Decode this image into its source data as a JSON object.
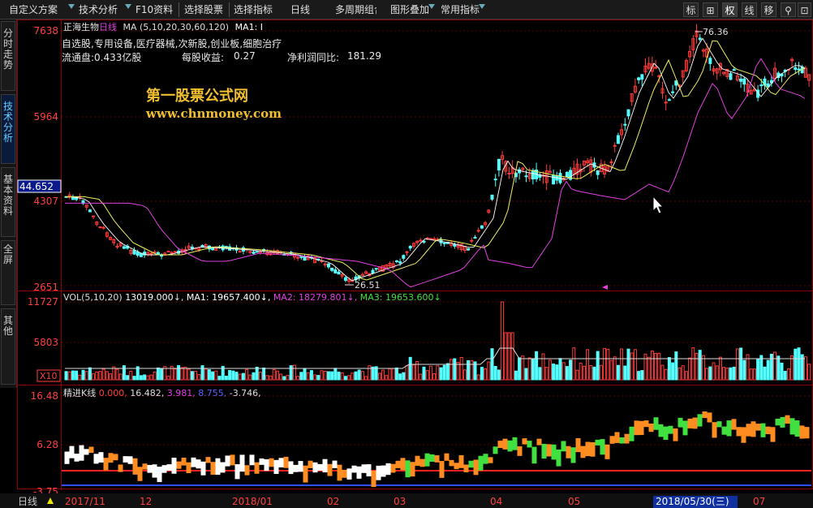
{
  "toolbar": {
    "menus": [
      {
        "label": "自定义方案"
      },
      {
        "label": "技术分析"
      },
      {
        "label": "F10资料"
      },
      {
        "label": "选择股票"
      },
      {
        "label": "选择指标"
      },
      {
        "label": "日线"
      },
      {
        "label": "多周期组合"
      },
      {
        "label": "图形叠加"
      },
      {
        "label": "常用指标"
      }
    ],
    "right_buttons": [
      "标",
      "⊞",
      "权",
      "线",
      "移",
      "⚲",
      "⊡",
      "✕"
    ]
  },
  "side_tabs": [
    {
      "label": "分时走势",
      "active": false
    },
    {
      "label": "技术分析",
      "active": true
    },
    {
      "label": "基本资料",
      "active": false
    },
    {
      "label": "全屏",
      "active": false
    },
    {
      "label": "其他",
      "active": false
    }
  ],
  "main_panel": {
    "stock_name": "正海生物",
    "period": "日线",
    "ma_params": "MA (5,10,20,30,60,120)",
    "ma1_label": "MA1: I",
    "tags": "自选股,专用设备,医疗器械,次新股,创业板,细胞治疗",
    "float_label": "流通盘:",
    "float_value": "0.433亿股",
    "eps_label": "每股收益:",
    "eps_value": "0.27",
    "profit_label": "净利润同比:",
    "profit_value": "181.29",
    "y_labels": [
      "7638",
      "5964",
      "4307",
      "2651"
    ],
    "cursor_price": "44.652",
    "high_marker": "76.36",
    "low_marker": "26.51",
    "watermark_title": "第一股票公式网",
    "watermark_url": "www.chnmoney.com"
  },
  "volume_panel": {
    "title": "VOL(5,10,20)",
    "vol_value": "13019.000",
    "ma1": "MA1: 19657.400",
    "ma2": "MA2: 18279.801",
    "ma3": "MA3: 19653.600",
    "y_labels": [
      "11727",
      "5803"
    ],
    "unit_label": "X10"
  },
  "indicator_panel": {
    "title": "精进K线",
    "values": [
      "0.000,",
      "16.482,",
      "3.981,",
      "8.755,",
      "-3.746,"
    ],
    "y_labels": [
      "16.48",
      "6.28",
      "-3.75"
    ]
  },
  "bottom_bar": {
    "period_label": "日线",
    "dates": [
      "2017/11",
      "12",
      "2018/01",
      "02",
      "03",
      "04",
      "05",
      "2018/05/30(三)",
      "07"
    ]
  },
  "colors": {
    "up": "#ff3b3b",
    "down": "#54ffff",
    "ma_white": "#ffffff",
    "ma_yellow": "#f0f060",
    "ma_magenta": "#e040e0",
    "ma_green": "#40e040",
    "grid_red": "#8b0000",
    "accent_blue": "#4070ff",
    "orange": "#ff8c20"
  }
}
